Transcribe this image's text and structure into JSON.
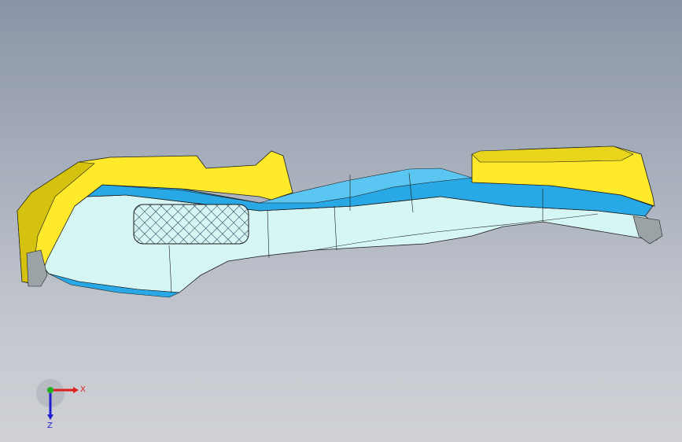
{
  "viewport": {
    "background_top": "#8a94a6",
    "background_bottom": "#cfd1d6"
  },
  "model": {
    "colors": {
      "yellow": "#ffe92b",
      "yellow_shade": "#d4c20e",
      "blue": "#29a8e6",
      "blue_light": "#5cc6f2",
      "cyan_surface": "#d6f6f4",
      "cyan_shade": "#b3e6e4",
      "grey": "#9aa3a6",
      "edge": "#1a1a1a"
    }
  },
  "triad": {
    "x_label": "X",
    "z_label": "Z",
    "x_color": "#e02020",
    "y_color": "#20b020",
    "z_color": "#2020d0"
  }
}
